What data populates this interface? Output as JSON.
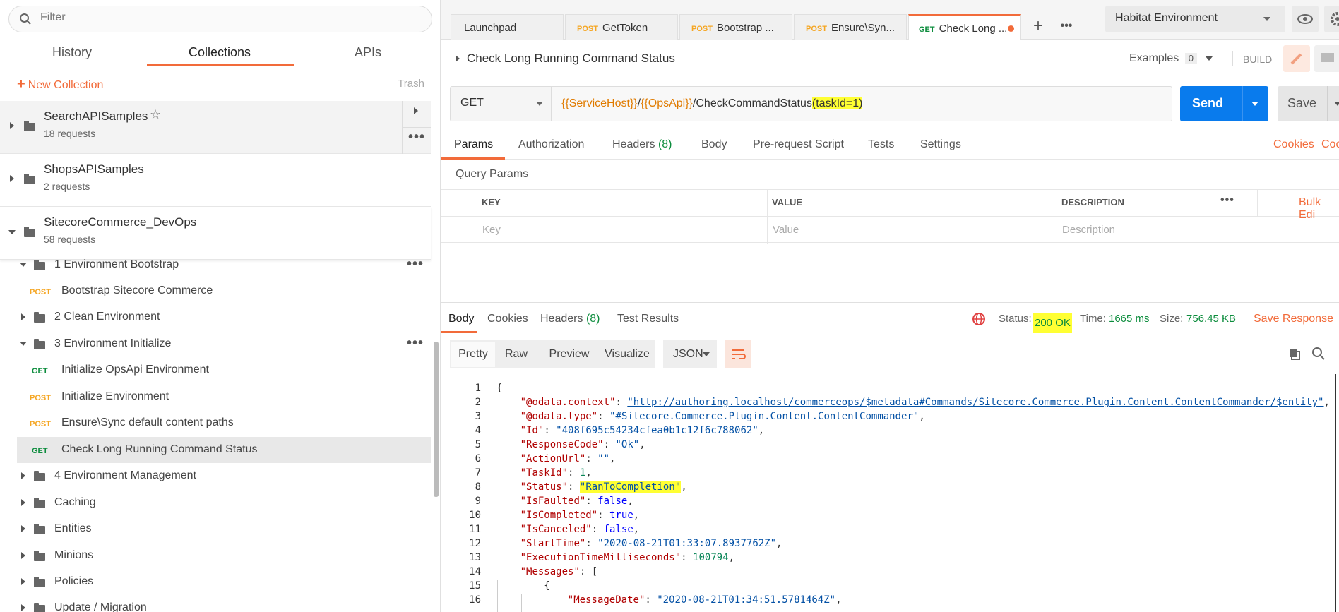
{
  "sidebar": {
    "filter_placeholder": "Filter",
    "tabs": [
      "History",
      "Collections",
      "APIs"
    ],
    "new_collection": "New Collection",
    "trash": "Trash",
    "collections": [
      {
        "name": "SearchAPISamples",
        "count": "18 requests"
      },
      {
        "name": "ShopsAPISamples",
        "count": "2 requests"
      },
      {
        "name": "SitecoreCommerce_DevOps",
        "count": "58 requests"
      }
    ],
    "tree": [
      {
        "label": "1 Environment Bootstrap"
      },
      {
        "method": "POST",
        "label": "Bootstrap Sitecore Commerce"
      },
      {
        "label": "2 Clean Environment"
      },
      {
        "label": "3 Environment Initialize"
      },
      {
        "method": "GET",
        "label": "Initialize OpsApi Environment"
      },
      {
        "method": "POST",
        "label": "Initialize Environment"
      },
      {
        "method": "POST",
        "label": "Ensure\\Sync default content paths"
      },
      {
        "method": "GET",
        "label": "Check Long Running Command Status"
      },
      {
        "label": "4 Environment Management"
      },
      {
        "label": "Caching"
      },
      {
        "label": "Entities"
      },
      {
        "label": "Minions"
      },
      {
        "label": "Policies"
      },
      {
        "label": "Update / Migration"
      }
    ]
  },
  "request_tabs": [
    {
      "method": "",
      "label": "Launchpad"
    },
    {
      "method": "POST",
      "label": "GetToken"
    },
    {
      "method": "POST",
      "label": "Bootstrap ..."
    },
    {
      "method": "POST",
      "label": "Ensure\\Syn..."
    },
    {
      "method": "GET",
      "label": "Check Long ..."
    }
  ],
  "environment": "Habitat Environment",
  "request": {
    "title": "Check Long Running Command Status",
    "examples_label": "Examples",
    "examples_count": "0",
    "build": "BUILD",
    "method": "GET",
    "url_var1": "{{ServiceHost}}",
    "url_sep": "/",
    "url_var2": "{{OpsApi}}",
    "url_path": "/CheckCommandStatus",
    "url_param": "(taskId=1)",
    "send": "Send",
    "save": "Save"
  },
  "subtabs": {
    "params": "Params",
    "authorization": "Authorization",
    "headers": "Headers",
    "headers_count": "(8)",
    "body": "Body",
    "prerequest": "Pre-request Script",
    "tests": "Tests",
    "settings": "Settings",
    "cookies": "Cookies",
    "code": "Coc"
  },
  "query_params": {
    "title": "Query Params",
    "col_key": "KEY",
    "col_value": "VALUE",
    "col_desc": "DESCRIPTION",
    "bulk_edit": "Bulk Edi",
    "ph_key": "Key",
    "ph_value": "Value",
    "ph_desc": "Description"
  },
  "response": {
    "tabs": {
      "body": "Body",
      "cookies": "Cookies",
      "headers": "Headers",
      "headers_count": "(8)",
      "tests": "Test Results"
    },
    "status_label": "Status:",
    "status": "200 OK",
    "time_label": "Time:",
    "time": "1665 ms",
    "size_label": "Size:",
    "size": "756.45 KB",
    "save_response": "Save Response",
    "view": [
      "Pretty",
      "Raw",
      "Preview",
      "Visualize"
    ],
    "format": "JSON"
  },
  "code_lines": [
    {
      "n": "1",
      "t": "{"
    },
    {
      "n": "2",
      "k": "\"@odata.context\"",
      "u": "\"http://authoring.localhost/commerceops/$metadata#Commands/Sitecore.Commerce.Plugin.Content.ContentCommander/$entity\"",
      "e": ","
    },
    {
      "n": "3",
      "k": "\"@odata.type\"",
      "s": "\"#Sitecore.Commerce.Plugin.Content.ContentCommander\"",
      "e": ","
    },
    {
      "n": "4",
      "k": "\"Id\"",
      "s": "\"408f695c54234cfea0b1c12f6c788062\"",
      "e": ","
    },
    {
      "n": "5",
      "k": "\"ResponseCode\"",
      "s": "\"Ok\"",
      "e": ","
    },
    {
      "n": "6",
      "k": "\"ActionUrl\"",
      "s": "\"\"",
      "e": ","
    },
    {
      "n": "7",
      "k": "\"TaskId\"",
      "num": "1",
      "e": ","
    },
    {
      "n": "8",
      "k": "\"Status\"",
      "s": "\"RanToCompletion\"",
      "e": ",",
      "hl": true
    },
    {
      "n": "9",
      "k": "\"IsFaulted\"",
      "b": "false",
      "e": ","
    },
    {
      "n": "10",
      "k": "\"IsCompleted\"",
      "b": "true",
      "e": ","
    },
    {
      "n": "11",
      "k": "\"IsCanceled\"",
      "b": "false",
      "e": ","
    },
    {
      "n": "12",
      "k": "\"StartTime\"",
      "s": "\"2020-08-21T01:33:07.8937762Z\"",
      "e": ","
    },
    {
      "n": "13",
      "k": "\"ExecutionTimeMilliseconds\"",
      "num": "100794",
      "e": ","
    },
    {
      "n": "14",
      "k": "\"Messages\"",
      "t2": "["
    },
    {
      "n": "15",
      "t": "{"
    },
    {
      "n": "16",
      "k": "\"MessageDate\"",
      "s": "\"2020-08-21T01:34:51.5781464Z\"",
      "e": ","
    }
  ]
}
